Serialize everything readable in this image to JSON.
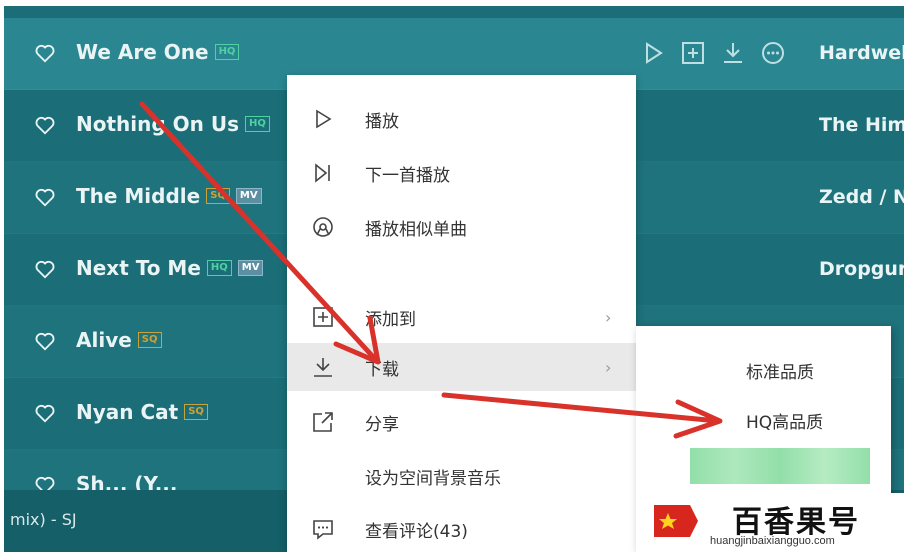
{
  "songs": [
    {
      "title": "We Are One",
      "badges": [
        "HQ"
      ],
      "artist": "Hardwel"
    },
    {
      "title": "Nothing On Us",
      "badges": [
        "HQ"
      ],
      "artist": "The Him"
    },
    {
      "title": "The Middle",
      "badges": [
        "SQ",
        "MV"
      ],
      "artist": "Zedd / N"
    },
    {
      "title": "Next To Me",
      "badges": [
        "HQ",
        "MV"
      ],
      "artist": "Dropgur"
    },
    {
      "title": "Alive",
      "badges": [
        "SQ"
      ],
      "artist": ""
    },
    {
      "title": "Nyan Cat",
      "badges": [
        "SQ"
      ],
      "artist": ""
    },
    {
      "title": "Sh... (Y...",
      "badges": [],
      "artist": ""
    }
  ],
  "row_action_icons": [
    "play-icon",
    "add-icon",
    "download-icon",
    "more-icon"
  ],
  "player": {
    "now_playing": "mix) - SJ"
  },
  "context_menu": {
    "items": [
      {
        "label": "播放",
        "icon": "play-outline-icon"
      },
      {
        "label": "下一首播放",
        "icon": "play-next-icon"
      },
      {
        "label": "播放相似单曲",
        "icon": "radio-icon"
      },
      {
        "label": "添加到",
        "icon": "add-to-icon",
        "submenu": true
      },
      {
        "label": "下载",
        "icon": "download-icon",
        "submenu": true
      },
      {
        "label": "分享",
        "icon": "share-icon"
      },
      {
        "label": "设为空间背景音乐",
        "icon": ""
      },
      {
        "label": "查看评论(43)",
        "icon": "comment-icon"
      }
    ]
  },
  "download_submenu": {
    "items": [
      {
        "label": "标准品质"
      },
      {
        "label": "HQ高品质"
      }
    ]
  },
  "watermark": {
    "name": "百香果号",
    "url": "huangjinbaixiangguo.com"
  },
  "colors": {
    "app_background": "#1b6e78",
    "hq_badge": "#4fd1a3",
    "sq_badge": "#c9a23a",
    "annotation_arrow": "#d9322b"
  }
}
